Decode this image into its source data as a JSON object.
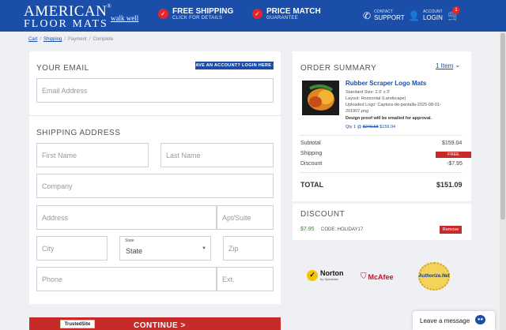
{
  "header": {
    "logo_line1": "AMERICAN",
    "logo_line2": "FLOOR MATS",
    "tagline": "walk well",
    "shipping_title": "FREE SHIPPING",
    "shipping_sub": "CLICK FOR DETAILS",
    "price_title": "PRICE MATCH",
    "price_sub": "GUARANTEE",
    "contact_small": "CONTACT",
    "contact_big": "SUPPORT",
    "account_small": "ACCOUNT",
    "account_big": "LOGIN",
    "cart_count": "1"
  },
  "breadcrumb": {
    "cart": "Cart",
    "shipping": "Shipping",
    "payment": "Payment",
    "complete": "Complete",
    "sep": "/"
  },
  "email": {
    "title": "YOUR EMAIL",
    "login_button": "HAVE AN ACCOUNT? LOGIN HERE ➜",
    "placeholder": "Email Address"
  },
  "shipping": {
    "title": "SHIPPING ADDRESS",
    "first_name": "First Name",
    "last_name": "Last Name",
    "company": "Company",
    "address": "Address",
    "apt": "Apt/Suite",
    "city": "City",
    "state_label": "State",
    "state_value": "State",
    "zip": "Zip",
    "phone": "Phone",
    "ext": "Ext."
  },
  "footer_btn": {
    "trusted": "TrustedSite",
    "continue": "CONTINUE >"
  },
  "summary": {
    "title": "ORDER SUMMARY",
    "items_link": "1 Item",
    "product_name": "Rubber Scraper Logo Mats",
    "size": "Standard Size: 2.5' x 3'",
    "layout": "Layout: Horizontal (Landscape)",
    "logo_line1": "Uploaded Logo: Captura-de-pantalla-2025-08-01-",
    "logo_line2": "201907.png",
    "proof": "Design proof will be emailed for approval.",
    "qty": "Qty 1 @",
    "old_price": "$249.58",
    "new_price": "$159.04",
    "subtotal_label": "Subtotal",
    "subtotal_value": "$159.04",
    "shipping_label": "Shipping",
    "shipping_value": "FREE",
    "discount_label": "Discount",
    "discount_value": "-$7.95",
    "total_label": "TOTAL",
    "total_value": "$151.09"
  },
  "discount": {
    "title": "DISCOUNT",
    "amount": "$7.95",
    "code": "CODE: HOLIDAY17",
    "remove": "Remove"
  },
  "trust": {
    "norton": "Norton",
    "norton_sub": "by Symantec",
    "mcafee": "McAfee",
    "authorize": "Authorize.Net"
  },
  "chat": {
    "label": "Leave a message"
  },
  "colors": {
    "brand_blue": "#1a4ea8",
    "accent_red": "#c82a2a"
  }
}
